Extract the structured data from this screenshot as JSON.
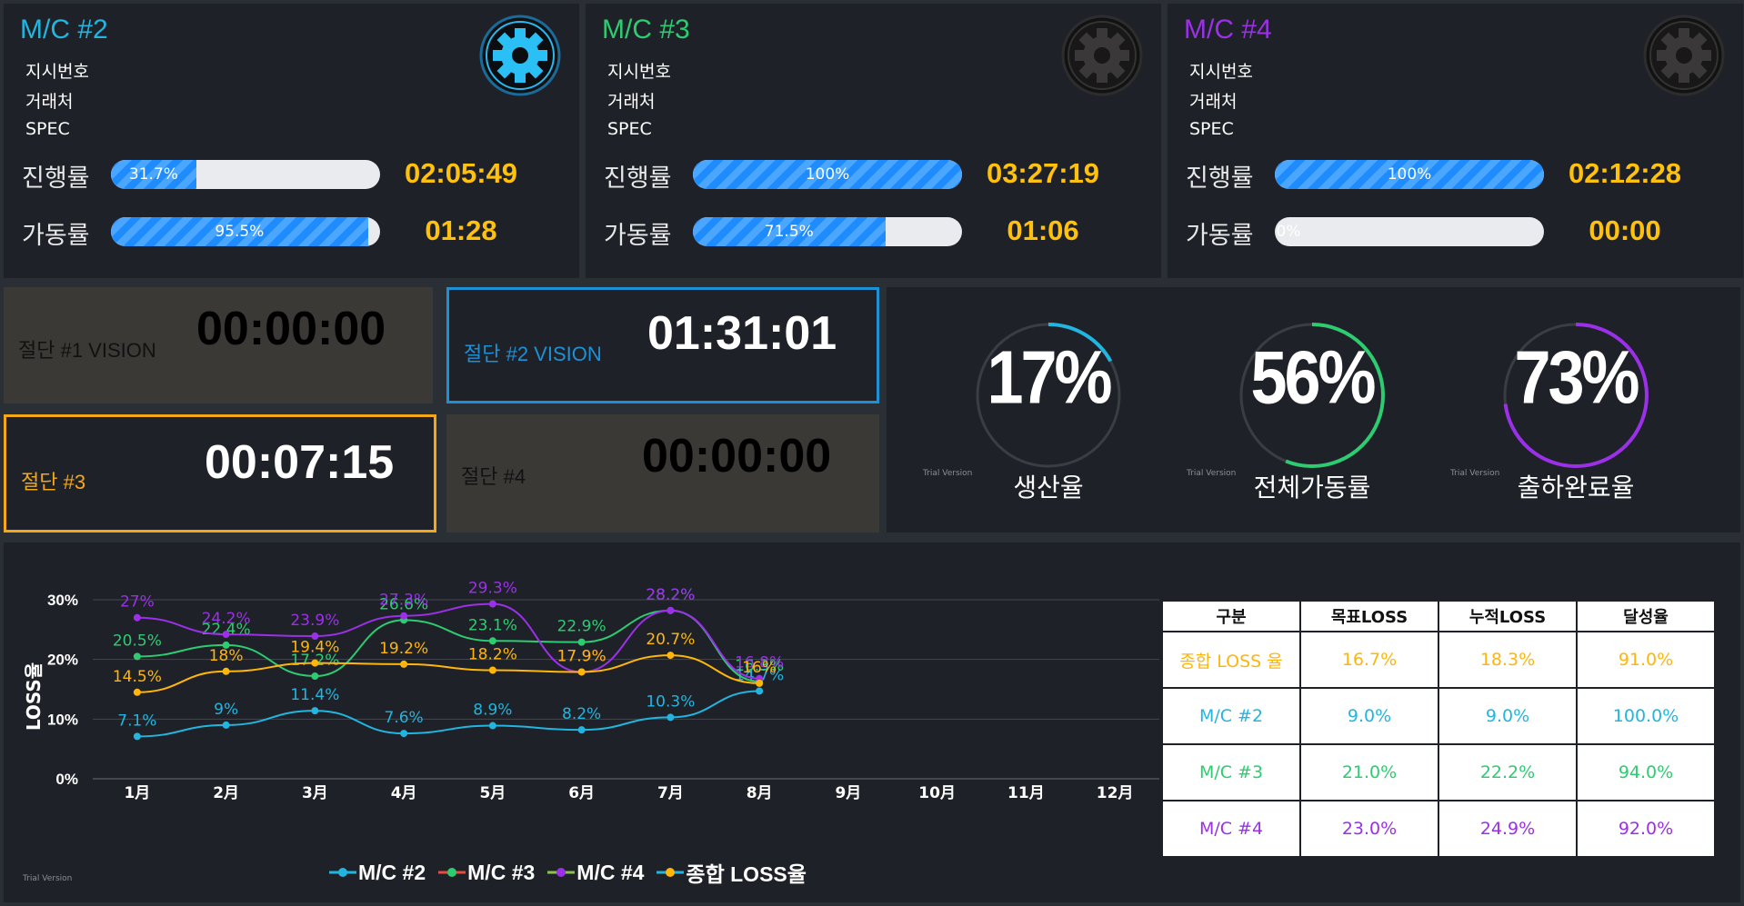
{
  "colors": {
    "mc2": "#22b5e0",
    "mc3": "#2ecc71",
    "mc4": "#9b30e8",
    "total": "#ffb60a",
    "time": "#ffc10e",
    "cut2_border": "#1e90d6",
    "cut3_border": "#f5a71a"
  },
  "machines": [
    {
      "title": "M/C #2",
      "info": [
        "지시번호",
        "거래처",
        "SPEC"
      ],
      "progress_label": "진행률",
      "progress_value": 31.7,
      "progress_text": "31.7%",
      "progress_time": "02:05:49",
      "uptime_label": "가동률",
      "uptime_value": 95.5,
      "uptime_text": "95.5%",
      "uptime_time": "01:28",
      "gear_active": true
    },
    {
      "title": "M/C #3",
      "info": [
        "지시번호",
        "거래처",
        "SPEC"
      ],
      "progress_label": "진행률",
      "progress_value": 100,
      "progress_text": "100%",
      "progress_time": "03:27:19",
      "uptime_label": "가동률",
      "uptime_value": 71.5,
      "uptime_text": "71.5%",
      "uptime_time": "01:06",
      "gear_active": false
    },
    {
      "title": "M/C #4",
      "info": [
        "지시번호",
        "거래처",
        "SPEC"
      ],
      "progress_label": "진행률",
      "progress_value": 100,
      "progress_text": "100%",
      "progress_time": "02:12:28",
      "uptime_label": "가동률",
      "uptime_value": 0,
      "uptime_text": "0%",
      "uptime_time": "00:00",
      "gear_active": false
    }
  ],
  "cuts": [
    {
      "label": "절단 #1 VISION",
      "time": "00:00:00"
    },
    {
      "label": "절단 #2 VISION",
      "time": "01:31:01"
    },
    {
      "label": "절단 #3",
      "time": "00:07:15"
    },
    {
      "label": "절단 #4",
      "time": "00:00:00"
    }
  ],
  "gauges": [
    {
      "value": 17,
      "text": "17%",
      "caption": "생산율",
      "color": "#22b5e0"
    },
    {
      "value": 56,
      "text": "56%",
      "caption": "전체가동률",
      "color": "#2ecc71"
    },
    {
      "value": 73,
      "text": "73%",
      "caption": "출하완료율",
      "color": "#9b30e8"
    }
  ],
  "trial_text": "Trial Version",
  "chart_data": {
    "type": "line",
    "categories": [
      "1月",
      "2月",
      "3月",
      "4月",
      "5月",
      "6月",
      "7月",
      "8月",
      "9月",
      "10月",
      "11月",
      "12月"
    ],
    "ylabel": "LOSS율",
    "ylim": [
      0,
      30
    ],
    "yticks": [
      "0%",
      "10%",
      "20%",
      "30%"
    ],
    "grid": true,
    "legend_position": "bottom",
    "series": [
      {
        "name": "M/C #2",
        "color": "#22b5e0",
        "values": [
          7.1,
          9,
          11.4,
          7.6,
          8.9,
          8.2,
          10.3,
          14.7
        ],
        "labels": [
          "7.1%",
          "9%",
          "11.4%",
          "7.6%",
          "8.9%",
          "8.2%",
          "10.3%",
          "14.7%"
        ]
      },
      {
        "name": "M/C #3",
        "color": "#2ecc71",
        "values": [
          20.5,
          22.4,
          17.2,
          26.6,
          23.1,
          22.9,
          28.2,
          16.3
        ],
        "labels": [
          "20.5%",
          "22.4%",
          "17.2%",
          "26.6%",
          "23.1%",
          "22.9%",
          "28.2%",
          "16.3%"
        ]
      },
      {
        "name": "M/C #4",
        "color": "#9b30e8",
        "values": [
          27,
          24.2,
          23.9,
          27.3,
          29.3,
          17.9,
          28.2,
          16.8
        ],
        "labels": [
          "27%",
          "24.2%",
          "23.9%",
          "27.3%",
          "29.3%",
          "17.9%",
          "28.2%",
          "16.8%"
        ]
      },
      {
        "name": "종합 LOSS율",
        "color": "#ffb60a",
        "values": [
          14.5,
          18,
          19.4,
          19.2,
          18.2,
          17.9,
          20.7,
          16
        ],
        "labels": [
          "14.5%",
          "18%",
          "19.4%",
          "19.2%",
          "18.2%",
          "17.9%",
          "20.7%",
          "16%"
        ]
      }
    ]
  },
  "table": {
    "headers": [
      "구분",
      "목표LOSS",
      "누적LOSS",
      "달성율"
    ],
    "rows": [
      {
        "cells": [
          "종합 LOSS 율",
          "16.7%",
          "18.3%",
          "91.0%"
        ],
        "color": "#ffb60a"
      },
      {
        "cells": [
          "M/C #2",
          "9.0%",
          "9.0%",
          "100.0%"
        ],
        "color": "#22b5e0"
      },
      {
        "cells": [
          "M/C #3",
          "21.0%",
          "22.2%",
          "94.0%"
        ],
        "color": "#2ecc71"
      },
      {
        "cells": [
          "M/C #4",
          "23.0%",
          "24.9%",
          "92.0%"
        ],
        "color": "#9b30e8"
      }
    ]
  }
}
